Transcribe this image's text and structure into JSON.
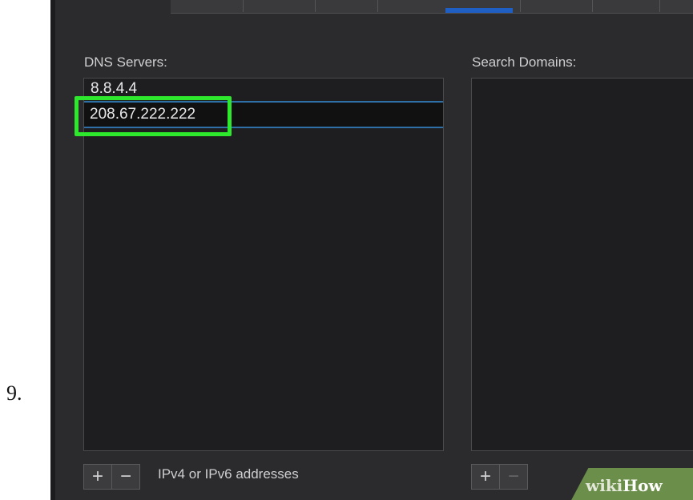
{
  "step": {
    "number": "9."
  },
  "tabbar": {
    "selected_indicator_color": "#1f5fc4"
  },
  "dns": {
    "label": "DNS Servers:",
    "entries": [
      "8.8.4.4",
      "208.67.222.222"
    ],
    "selected_index": 1,
    "add_label": "+",
    "remove_label": "−",
    "hint": "IPv4 or IPv6 addresses"
  },
  "search": {
    "label": "Search Domains:",
    "entries": [],
    "add_label": "+",
    "remove_label": "−"
  },
  "highlight": {
    "color": "#2ee82e"
  },
  "watermark": {
    "wiki": "wiki",
    "how": "How"
  }
}
